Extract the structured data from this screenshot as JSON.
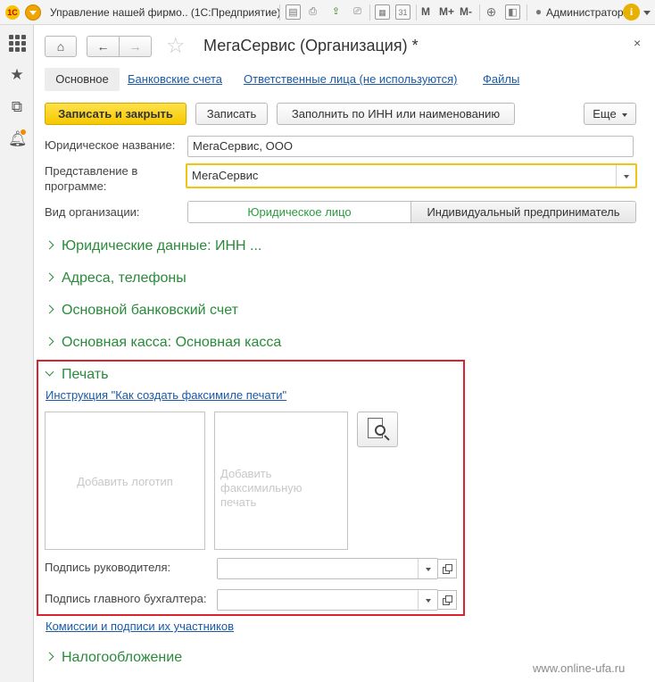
{
  "titlebar": {
    "logo_text": "1С",
    "title": "Управление нашей фирмо.. (1С:Предприятие)",
    "m_labels": [
      "M",
      "M+",
      "M-"
    ],
    "user": "Администратор",
    "info_glyph": "i",
    "icons": [
      "save-icon",
      "print-icon",
      "upload-icon",
      "print-preview-icon",
      "calculator-icon",
      "calendar-icon",
      "search-zoom-icon",
      "window-panel-icon",
      "user-icon",
      "info-icon"
    ]
  },
  "sidebar": {
    "icons": [
      "apps-grid-icon",
      "favorites-star-icon",
      "history-icon",
      "notifications-bell-icon"
    ],
    "notification_dot_color": "#f08c00"
  },
  "form": {
    "title": "МегаСервис (Организация) *",
    "nav": {
      "home_glyph": "⌂",
      "back_glyph": "←",
      "forward_glyph": "→",
      "close_glyph": "×"
    },
    "tabs": [
      {
        "label": "Основное",
        "active": true
      },
      {
        "label": "Банковские счета",
        "active": false
      },
      {
        "label": "Ответственные лица (не используются)",
        "active": false
      },
      {
        "label": "Файлы",
        "active": false
      }
    ],
    "toolbar": {
      "save_close": "Записать и закрыть",
      "save": "Записать",
      "fill_by_inn": "Заполнить по ИНН или наименованию",
      "more": "Еще"
    },
    "fields": {
      "legal_name_label": "Юридическое название:",
      "legal_name_value": "МегаСервис, ООО",
      "display_label_line1": "Представление в",
      "display_label_line2": "программе:",
      "display_value": "МегаСервис",
      "org_type_label": "Вид организации:",
      "org_type_options": [
        "Юридическое лицо",
        "Индивидуальный предприниматель"
      ],
      "org_type_selected": "Юридическое лицо"
    },
    "sections": {
      "legal": "Юридические данные: ИНН ...",
      "addresses": "Адреса, телефоны",
      "bank": "Основной банковский счет",
      "cash": "Основная касса: Основная касса",
      "print": "Печать",
      "taxation": "Налогообложение"
    },
    "print": {
      "instruction_link": "Инструкция \"Как создать факсимиле печати\"",
      "add_logo": "Добавить логотип",
      "add_stamp_line1": "Добавить",
      "add_stamp_line2": "факсимильную",
      "add_stamp_line3": "печать",
      "director_label": "Подпись руководителя:",
      "director_value": "",
      "accountant_label": "Подпись главного бухгалтера:",
      "accountant_value": ""
    },
    "commissions_link": "Комиссии и подписи их участников"
  },
  "watermark": "www.online-ufa.ru",
  "colors": {
    "accent_green": "#2a8a3a",
    "link_blue": "#1a5aa8",
    "primary_button": "#f6c800",
    "focus_border": "#f1c40f",
    "highlight_frame": "#d9232e"
  }
}
